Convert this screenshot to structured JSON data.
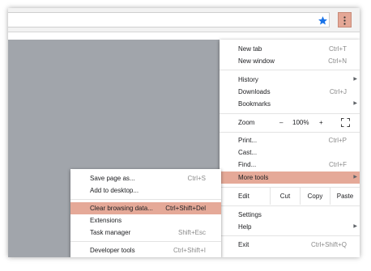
{
  "colors": {
    "highlight": "#e5a998",
    "page_gray": "#a1a5ab",
    "star": "#1a73e8"
  },
  "icons": {
    "bookmark": "star-icon",
    "menu": "kebab-menu-icon",
    "fullscreen": "fullscreen-icon",
    "submenu": "chevron-right-icon"
  },
  "main_menu": {
    "new_tab": {
      "label": "New tab",
      "shortcut": "Ctrl+T"
    },
    "new_window": {
      "label": "New window",
      "shortcut": "Ctrl+N"
    },
    "history": {
      "label": "History",
      "arrow": "▶"
    },
    "downloads": {
      "label": "Downloads",
      "shortcut": "Ctrl+J"
    },
    "bookmarks": {
      "label": "Bookmarks",
      "arrow": "▶"
    },
    "zoom": {
      "label": "Zoom",
      "minus": "–",
      "value": "100%",
      "plus": "+"
    },
    "print": {
      "label": "Print...",
      "shortcut": "Ctrl+P"
    },
    "cast": {
      "label": "Cast..."
    },
    "find": {
      "label": "Find...",
      "shortcut": "Ctrl+F"
    },
    "more_tools": {
      "label": "More tools",
      "arrow": "▶"
    },
    "edit": {
      "label": "Edit",
      "cut": "Cut",
      "copy": "Copy",
      "paste": "Paste"
    },
    "settings": {
      "label": "Settings"
    },
    "help": {
      "label": "Help",
      "arrow": "▶"
    },
    "exit": {
      "label": "Exit",
      "shortcut": "Ctrl+Shift+Q"
    }
  },
  "more_tools_menu": {
    "save_page": {
      "label": "Save page as...",
      "shortcut": "Ctrl+S"
    },
    "add_to_desktop": {
      "label": "Add to desktop..."
    },
    "clear_browsing": {
      "label": "Clear browsing data...",
      "shortcut": "Ctrl+Shift+Del"
    },
    "extensions": {
      "label": "Extensions"
    },
    "task_manager": {
      "label": "Task manager",
      "shortcut": "Shift+Esc"
    },
    "developer_tools": {
      "label": "Developer tools",
      "shortcut": "Ctrl+Shift+I"
    }
  }
}
